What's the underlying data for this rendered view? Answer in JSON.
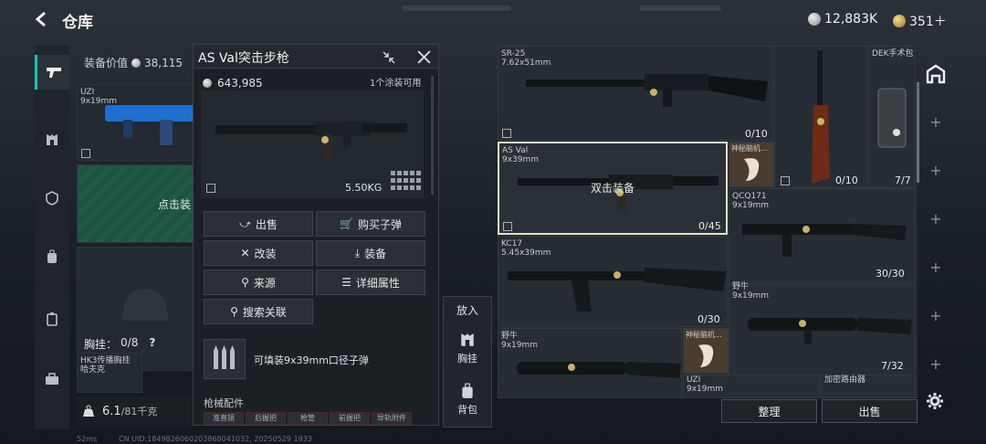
{
  "header": {
    "title": "仓库",
    "silver": "12,883K",
    "gold": "351＋"
  },
  "equip_value": {
    "label": "装备价值",
    "value": "38,115"
  },
  "uzi_left": {
    "name": "UZI",
    "cal": "9x19mm"
  },
  "click_equip": "点击装",
  "chest_rig": {
    "label": "胸挂：",
    "count": "0/8",
    "help": "?"
  },
  "hk_item": {
    "line1": "HK3传播胸挂",
    "line2": "哈夫克"
  },
  "weight": {
    "value": "6.1",
    "max": "/81千克"
  },
  "popup": {
    "title": "AS Val突击步枪",
    "price": "643,985",
    "paint": "1个涂装可用",
    "weight": "5.50KG",
    "buttons": {
      "sell": "出售",
      "buy_ammo": "购买子弹",
      "modify": "改装",
      "equip": "装备",
      "source": "来源",
      "details": "详细属性",
      "search_related": "搜索关联"
    },
    "ammo_text": "可填装9x39mm口径子弹",
    "accessories_label": "枪械配件",
    "acc_tabs": [
      "准直镜",
      "后握把",
      "枪管",
      "前握把",
      "导轨附件"
    ]
  },
  "put": {
    "title": "放入",
    "chest": "胸挂",
    "backpack": "背包"
  },
  "grid": {
    "sr25": {
      "name": "SR-25",
      "cal": "7.62x51mm",
      "count": "0/10"
    },
    "rifle2": {
      "count": "0/10"
    },
    "dek": {
      "name": "DEK手术包",
      "count": "7/7"
    },
    "asval": {
      "name": "AS Val",
      "cal": "9x39mm",
      "hint": "双击装备",
      "count": "0/45"
    },
    "mystery1": {
      "name": "神秘脑机..."
    },
    "qcq": {
      "name": "QCQ171",
      "cal": "9x19mm",
      "count": "30/30"
    },
    "kc17": {
      "name": "KC17",
      "cal": "5.45x39mm",
      "count": "0/30"
    },
    "bison1": {
      "name": "野牛",
      "cal": "9x19mm",
      "count": "7/32"
    },
    "bison2": {
      "name": "野牛",
      "cal": "9x19mm"
    },
    "mystery2": {
      "name": "神秘脑机..."
    },
    "uzi": {
      "name": "UZI",
      "cal": "9x19mm"
    },
    "router": {
      "name": "加密路由器"
    }
  },
  "bottom": {
    "sort": "整理",
    "sell": "出售"
  },
  "footer": {
    "ms": "52ms",
    "uid": "CN UID:1849826060203868041032, 20250529 1933"
  }
}
